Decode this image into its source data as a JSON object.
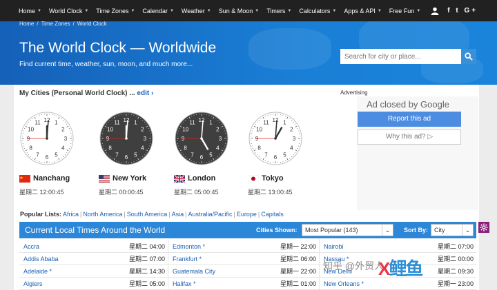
{
  "nav": {
    "items": [
      "Home",
      "World Clock",
      "Time Zones",
      "Calendar",
      "Weather",
      "Sun & Moon",
      "Timers",
      "Calculators",
      "Apps & API",
      "Free Fun"
    ],
    "social": "f t G+",
    "icons": [
      "user-icon",
      "facebook-icon",
      "twitter-icon",
      "google-plus-icon",
      "search-icon"
    ]
  },
  "breadcrumb": [
    "Home",
    "/",
    "Time Zones",
    "/",
    "World Clock"
  ],
  "header": {
    "title": "The World Clock — Worldwide",
    "subtitle": "Find current time, weather, sun, moon, and much more..."
  },
  "search": {
    "placeholder": "Search for city or place..."
  },
  "mycities": {
    "label": "My Cities (Personal World Clock) ...",
    "edit": "edit ›"
  },
  "cities": [
    {
      "name": "Nanchang",
      "time": "星期二 12:00:45",
      "flag": "china-flag",
      "h": 12,
      "m": 0,
      "s": 45
    },
    {
      "name": "New York",
      "time": "星期二 00:00:45",
      "flag": "usa-flag",
      "h": 0,
      "m": 0,
      "s": 45
    },
    {
      "name": "London",
      "time": "星期二 05:00:45",
      "flag": "uk-flag",
      "h": 5,
      "m": 0,
      "s": 45
    },
    {
      "name": "Tokyo",
      "time": "星期二 13:00:45",
      "flag": "japan-flag",
      "h": 13,
      "m": 0,
      "s": 45
    }
  ],
  "clock_numbers": [
    "12",
    "1",
    "2",
    "3",
    "4",
    "5",
    "6",
    "7",
    "8",
    "9",
    "10",
    "11"
  ],
  "ad": {
    "label": "Advertising",
    "closed": "Ad closed by Google",
    "report": "Report this ad",
    "why": "Why this ad? ▷"
  },
  "popular": {
    "label": "Popular Lists:",
    "links": [
      "Africa",
      "North America",
      "South America",
      "Asia",
      "Australia/Pacific",
      "Europe",
      "Capitals"
    ],
    "sep": "|"
  },
  "table": {
    "title": "Current Local Times Around the World",
    "cities_label": "Cities Shown:",
    "cities_value": "Most Popular (143)",
    "sort_label": "Sort By:",
    "sort_value": "City",
    "rows": [
      [
        {
          "c": "Accra",
          "t": "星期二 04:00"
        },
        {
          "c": "Edmonton *",
          "t": "星期一 22:00"
        },
        {
          "c": "Nairobi",
          "t": "星期二 07:00"
        }
      ],
      [
        {
          "c": "Addis Ababa",
          "t": "星期二 07:00"
        },
        {
          "c": "Frankfurt *",
          "t": "星期二 06:00"
        },
        {
          "c": "Nassau *",
          "t": "星期二 00:00"
        }
      ],
      [
        {
          "c": "Adelaide *",
          "t": "星期二 14:30"
        },
        {
          "c": "Guatemala City",
          "t": "星期一 22:00"
        },
        {
          "c": "New Delhi",
          "t": "星期二 09:30"
        }
      ],
      [
        {
          "c": "Algiers",
          "t": "星期二 05:00"
        },
        {
          "c": "Halifax *",
          "t": "星期二 01:00"
        },
        {
          "c": "New Orleans *",
          "t": "星期一 23:00"
        }
      ]
    ]
  },
  "watermark": {
    "text": "知乎 @外贸人",
    "logo_x": "X",
    "logo_rest": "鲤鱼"
  }
}
